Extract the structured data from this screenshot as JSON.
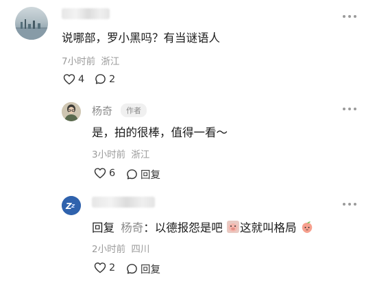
{
  "comments": [
    {
      "text": "说哪部，罗小黑吗？有当谜语人",
      "time": "7小时前",
      "location": "浙江",
      "likes": "4",
      "replies": "2"
    }
  ],
  "replies": [
    {
      "author": "杨奇",
      "author_tag": "作者",
      "text": "是，拍的很棒，值得一看～",
      "time": "3小时前",
      "location": "浙江",
      "likes": "6",
      "reply_label": "回复"
    },
    {
      "reply_prefix": "回复",
      "reply_to": "杨奇",
      "text_a": "：以德报怨是吧",
      "text_b": "这就叫格局",
      "time": "2小时前",
      "location": "四川",
      "likes": "2",
      "reply_label": "回复"
    }
  ],
  "colors": {
    "meta": "#9a9a9a",
    "name": "#8a8a8a",
    "text": "#1a1a1a"
  },
  "icons": [
    "more-dots-icon",
    "heart-icon",
    "comment-bubble-icon",
    "pig-emoji-icon",
    "peach-emoji-icon"
  ]
}
